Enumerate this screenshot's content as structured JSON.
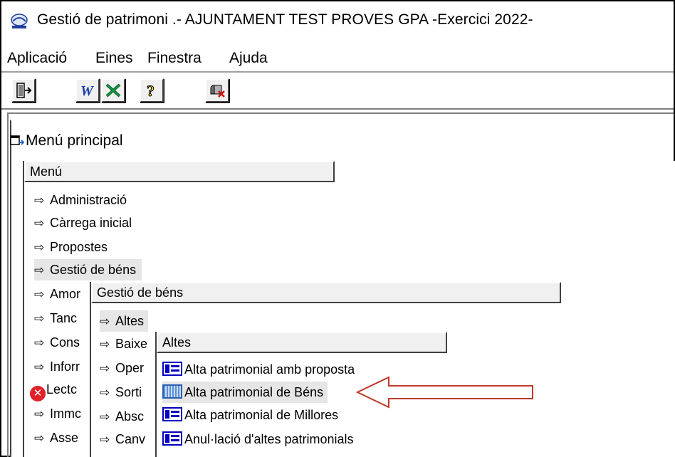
{
  "window": {
    "title": "Gestió de patrimoni .- AJUNTAMENT TEST PROVES GPA -Exercici 2022-"
  },
  "menubar": {
    "items": [
      "Aplicació",
      "Eines",
      "Finestra",
      "Ajuda"
    ]
  },
  "toolbar": {
    "buttons": [
      "exit-icon",
      "word-icon",
      "excel-icon",
      "help-icon",
      "mail-icon"
    ]
  },
  "child_window": {
    "title": "Menú principal"
  },
  "main_menu": {
    "header": "Menú",
    "items": [
      "Administració",
      "Càrrega inicial",
      "Propostes",
      "Gestió de béns",
      "Amor",
      "Tanc",
      "Cons",
      "Inforr",
      "Lectc",
      "Immc",
      "Asse"
    ]
  },
  "submenu_gestio": {
    "header": "Gestió de béns",
    "items": [
      "Altes",
      "Baixe",
      "Oper",
      "Sorti",
      "Absc",
      "Canv"
    ]
  },
  "submenu_altes": {
    "header": "Altes",
    "items": [
      "Alta patrimonial amb proposta",
      "Alta patrimonial de Béns",
      "Alta patrimonial de Millores",
      "Anul·lació d'altes patrimonials"
    ]
  },
  "colors": {
    "annotation_arrow": "#c0392b",
    "icon_blue": "#0000c0"
  }
}
